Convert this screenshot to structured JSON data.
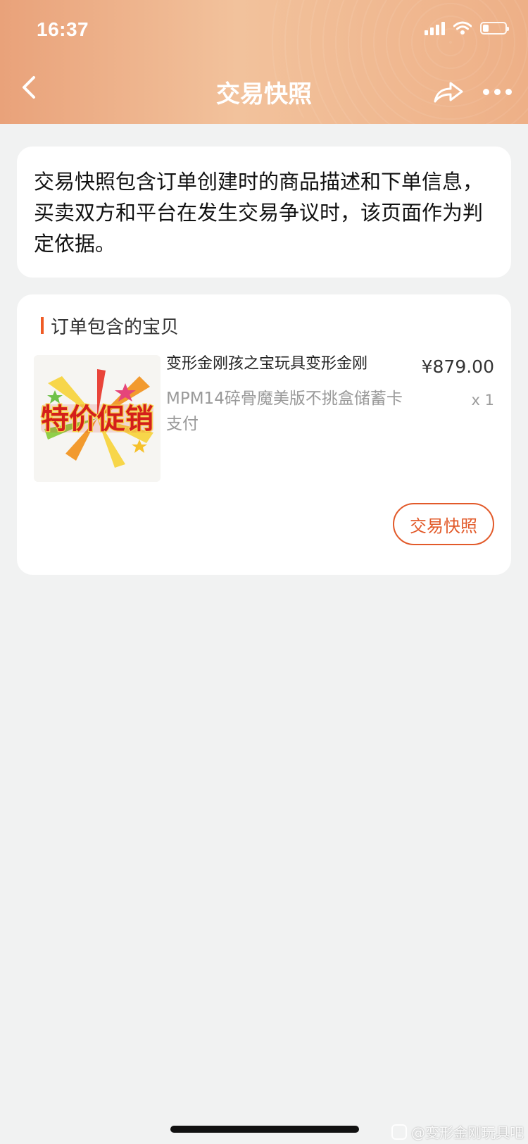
{
  "status_bar": {
    "time": "16:37"
  },
  "nav": {
    "title": "交易快照"
  },
  "notice": {
    "text": "交易快照包含订单创建时的商品描述和下单信息，买卖双方和平台在发生交易争议时，该页面作为判定依据。"
  },
  "goods_section": {
    "title": "订单包含的宝贝",
    "item": {
      "promo_image_text": "特价促销",
      "name": "变形金刚孩之宝玩具变形金刚",
      "spec": "MPM14碎骨魔美版不挑盒储蓄卡支付",
      "price": "¥879.00",
      "quantity": "x 1"
    },
    "snapshot_button": "交易快照"
  },
  "watermark": {
    "text": "@变形金刚玩具吧"
  },
  "colors": {
    "accent": "#e25a2a",
    "header_start": "#e9a27a",
    "header_end": "#f2c29c"
  }
}
